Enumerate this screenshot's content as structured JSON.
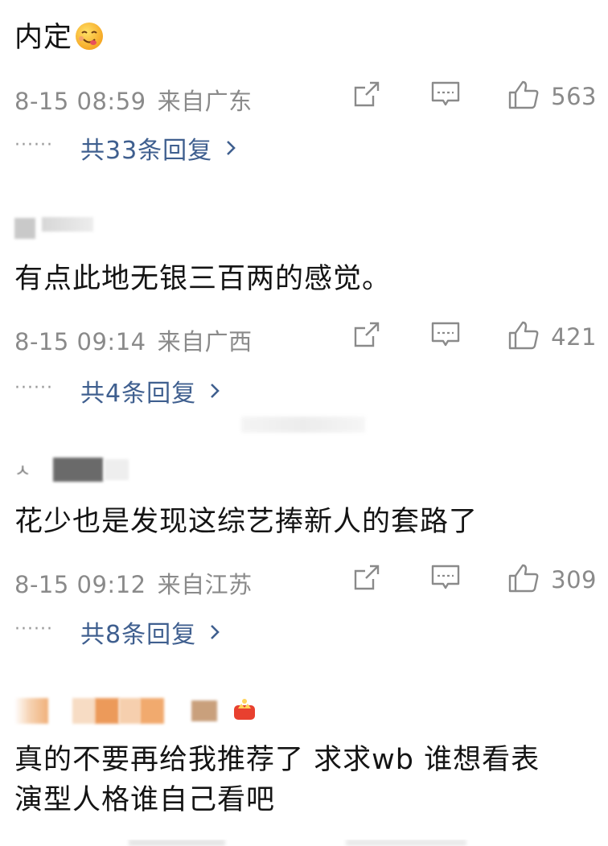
{
  "comments": [
    {
      "username": "",
      "text": "内定",
      "time": "8-15 08:59",
      "location": "来自广东",
      "likes": "563",
      "replies": "共33条回复",
      "emoji": "yum-face-emoji"
    },
    {
      "username": "",
      "text": "有点此地无银三百两的感觉。",
      "time": "8-15 09:14",
      "location": "来自广西",
      "likes": "421",
      "replies": "共4条回复"
    },
    {
      "username": "",
      "text": "花少也是发现这综艺捧新人的套路了",
      "time": "8-15 09:12",
      "location": "来自江苏",
      "likes": "309",
      "replies": "共8条回复"
    },
    {
      "username": "",
      "text_line1": "真的不要再给我推荐了 求求wb 谁想看表",
      "text_line2": "演型人格谁自己看吧"
    }
  ],
  "icons": {
    "share": "share-icon",
    "comment": "comment-icon",
    "like": "thumbs-up-icon",
    "more_replies": "chevron-right-icon"
  },
  "colors": {
    "meta_gray": "#8a8a8a",
    "reply_link_blue": "#3f5f8f",
    "text": "#141414"
  }
}
